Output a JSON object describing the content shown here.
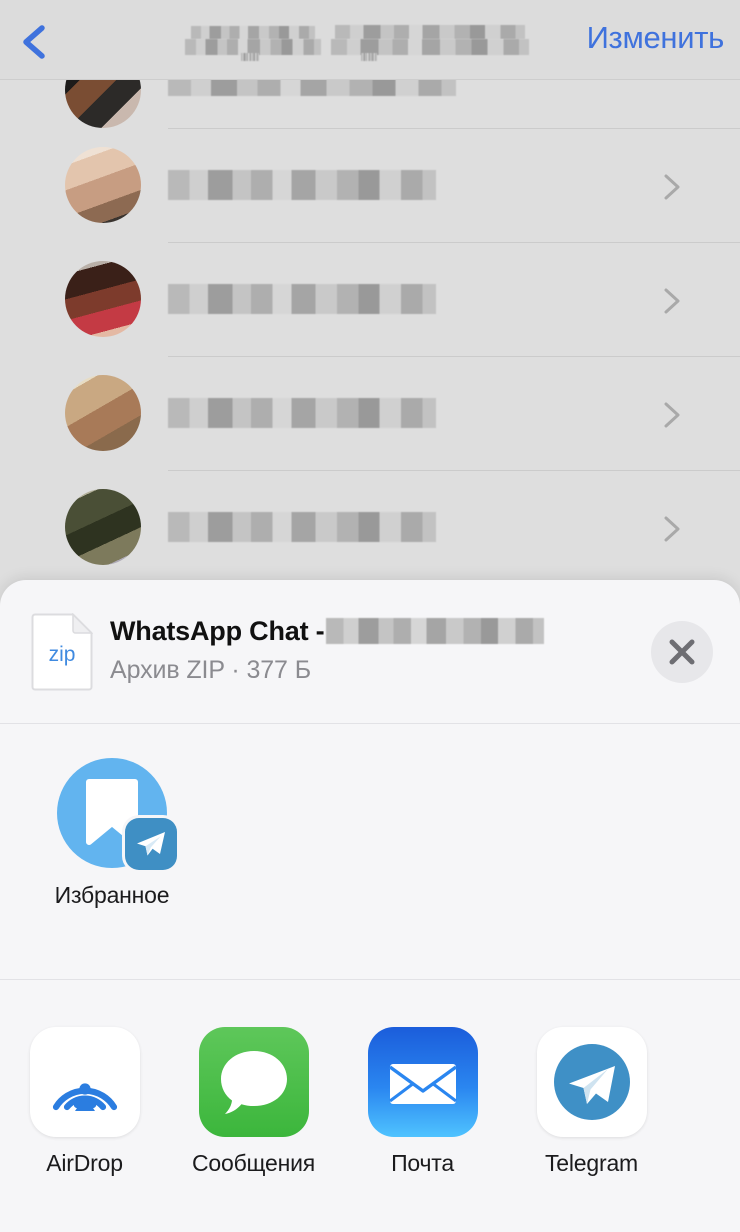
{
  "nav": {
    "back_icon": "chevron-left-icon",
    "title_redacted": "[redacted contact name]",
    "edit_label": "Изменить"
  },
  "contacts": {
    "rows": [
      {
        "phone_redacted": "+7 920 000-00-00",
        "chevron": "chevron-right-icon",
        "avatar_colors": [
          "#1d1b1a",
          "#7a4d33",
          "#2c2a28",
          "#c9b8ae"
        ]
      },
      {
        "phone_redacted": "+7 925 110-73-23",
        "chevron": "chevron-right-icon",
        "avatar_colors": [
          "#e3c5ad",
          "#c79d82",
          "#efe1d4",
          "#3a342f"
        ]
      },
      {
        "phone_redacted": "+7 926 540-51-81",
        "chevron": "chevron-right-icon",
        "avatar_colors": [
          "#3a2018",
          "#7d3b2c",
          "#c43a44",
          "#e4b9a4"
        ]
      },
      {
        "phone_redacted": "+7 950 095-58-71",
        "chevron": "chevron-right-icon",
        "avatar_colors": [
          "#c9a882",
          "#a87a58",
          "#e7dcc4",
          "#8a6a4c"
        ]
      },
      {
        "phone_redacted": "+7 951 990-40-58",
        "chevron": "chevron-right-icon",
        "avatar_colors": [
          "#4a4f36",
          "#2e3320",
          "#7d7a5c",
          "#b3b09a"
        ]
      }
    ]
  },
  "share_sheet": {
    "file": {
      "icon": "zip-file-icon",
      "icon_text": "zip",
      "title": "WhatsApp Chat - ",
      "title_redacted": "[redacted chat name]",
      "subtitle": "Архив ZIP · 377 Б",
      "close_icon": "close-icon"
    },
    "suggestions": [
      {
        "label": "Избранное",
        "avatar_icon": "bookmark-icon",
        "badge_icon": "telegram-icon",
        "circle_color": "#62b4ef",
        "badge_color": "#3f8fc4"
      }
    ],
    "apps": [
      {
        "label": "AirDrop",
        "icon": "airdrop-icon",
        "bg": "#ffffff"
      },
      {
        "label": "Сообщения",
        "icon": "messages-icon",
        "bg": "#5bd35b"
      },
      {
        "label": "Почта",
        "icon": "mail-icon",
        "bg": "#1d6ff2"
      },
      {
        "label": "Telegram",
        "icon": "telegram-icon",
        "bg": "#ffffff"
      }
    ]
  },
  "colors": {
    "accent_blue": "#3f72dd",
    "sheet_bg": "#f6f6f8",
    "screen_bg": "#dedede",
    "secondary_text": "#8b8b90"
  }
}
